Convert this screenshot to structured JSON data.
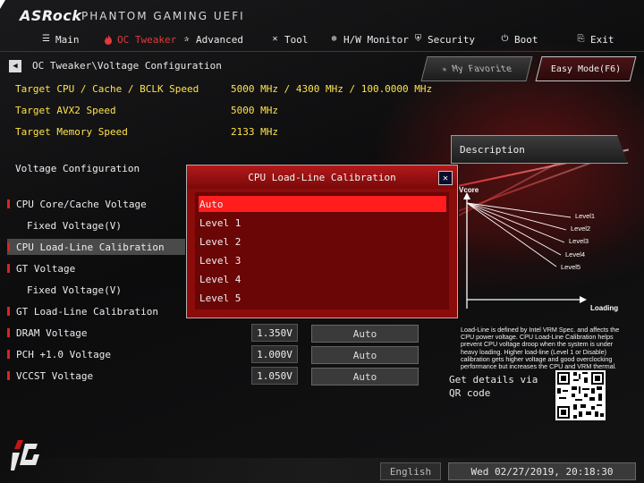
{
  "header": {
    "logo": "ASRock",
    "logo_sub": "PHANTOM GAMING UEFI"
  },
  "tabs": [
    {
      "label": "Main",
      "icon": "list-icon"
    },
    {
      "label": "OC Tweaker",
      "icon": "flame-icon",
      "active": true
    },
    {
      "label": "Advanced",
      "icon": "star-icon"
    },
    {
      "label": "Tool",
      "icon": "tools-icon"
    },
    {
      "label": "H/W Monitor",
      "icon": "monitor-icon"
    },
    {
      "label": "Security",
      "icon": "shield-icon"
    },
    {
      "label": "Boot",
      "icon": "power-icon"
    },
    {
      "label": "Exit",
      "icon": "exit-icon"
    }
  ],
  "breadcrumb": "OC Tweaker\\Voltage Configuration",
  "buttons": {
    "favorite": "My Favorite",
    "easy_mode": "Easy Mode(F6)"
  },
  "info": [
    {
      "label": "Target CPU / Cache / BCLK Speed",
      "value": "5000 MHz / 4300 MHz / 100.0000 MHz"
    },
    {
      "label": "Target AVX2 Speed",
      "value": "5000 MHz"
    },
    {
      "label": "Target Memory Speed",
      "value": "2133 MHz"
    }
  ],
  "section_title": "Voltage Configuration",
  "rows": [
    {
      "label": "CPU Core/Cache Voltage",
      "mark": true
    },
    {
      "label": "Fixed Voltage(V)",
      "mark": false
    },
    {
      "label": "CPU Load-Line Calibration",
      "mark": true
    },
    {
      "label": "GT Voltage",
      "mark": true
    },
    {
      "label": "Fixed Voltage(V)",
      "mark": false
    },
    {
      "label": "GT Load-Line Calibration",
      "mark": true
    },
    {
      "label": "DRAM Voltage",
      "mark": true,
      "voltage": "1.350V",
      "setting": "Auto"
    },
    {
      "label": "PCH +1.0 Voltage",
      "mark": true,
      "voltage": "1.000V",
      "setting": "Auto"
    },
    {
      "label": "VCCST Voltage",
      "mark": true,
      "voltage": "1.050V",
      "setting": "Auto"
    }
  ],
  "description": {
    "title": "Description",
    "graph": {
      "y_label": "Vcore",
      "x_label": "Loading",
      "lines": [
        "Level1",
        "Level2",
        "Level3",
        "Level4",
        "Level5"
      ]
    },
    "text": "Load-Line is defined by Intel VRM Spec. and affects the CPU power voltage. CPU Load-Line Calibration helps prevent CPU voltage droop when the system is under heavy loading. Higher load-line (Level 1 or Disable) calibration gets higher voltage and good overclocking performance but increases the CPU and VRM thermal.",
    "qr_text": "Get details via QR code"
  },
  "popup": {
    "title": "CPU Load-Line Calibration",
    "options": [
      "Auto",
      "Level 1",
      "Level 2",
      "Level 3",
      "Level 4",
      "Level 5"
    ],
    "selected": "Auto"
  },
  "footer": {
    "language": "English",
    "datetime": "Wed 02/27/2019, 20:18:30"
  },
  "colors": {
    "accent_red": "#e23a3a",
    "info_yellow": "#ffe34a",
    "popup_bg": "#8c0b0b",
    "option_selected": "#ff1d1d"
  }
}
